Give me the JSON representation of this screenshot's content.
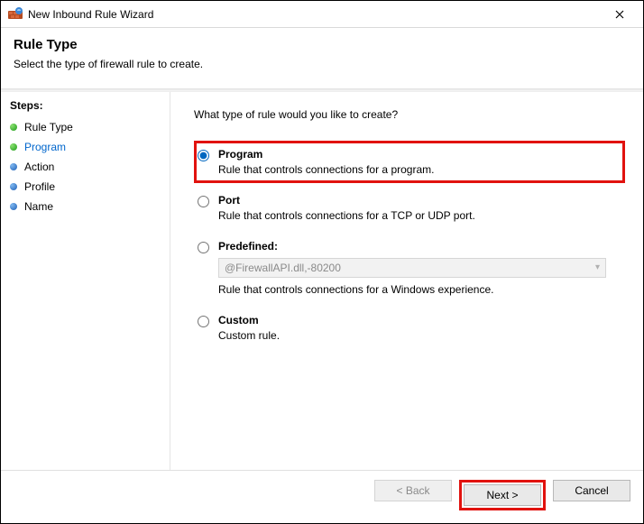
{
  "window": {
    "title": "New Inbound Rule Wizard"
  },
  "header": {
    "title": "Rule Type",
    "subtitle": "Select the type of firewall rule to create."
  },
  "sidebar": {
    "label": "Steps:",
    "steps": [
      {
        "label": "Rule Type",
        "bullet": "green",
        "current": false
      },
      {
        "label": "Program",
        "bullet": "green",
        "current": true
      },
      {
        "label": "Action",
        "bullet": "blue",
        "current": false
      },
      {
        "label": "Profile",
        "bullet": "blue",
        "current": false
      },
      {
        "label": "Name",
        "bullet": "blue",
        "current": false
      }
    ]
  },
  "main": {
    "prompt": "What type of rule would you like to create?",
    "options": {
      "program": {
        "title": "Program",
        "desc": "Rule that controls connections for a program."
      },
      "port": {
        "title": "Port",
        "desc": "Rule that controls connections for a TCP or UDP port."
      },
      "predefined": {
        "title": "Predefined:",
        "selected_value": "@FirewallAPI.dll,-80200",
        "desc": "Rule that controls connections for a Windows experience."
      },
      "custom": {
        "title": "Custom",
        "desc": "Custom rule."
      }
    }
  },
  "footer": {
    "back": "< Back",
    "next": "Next >",
    "cancel": "Cancel"
  }
}
